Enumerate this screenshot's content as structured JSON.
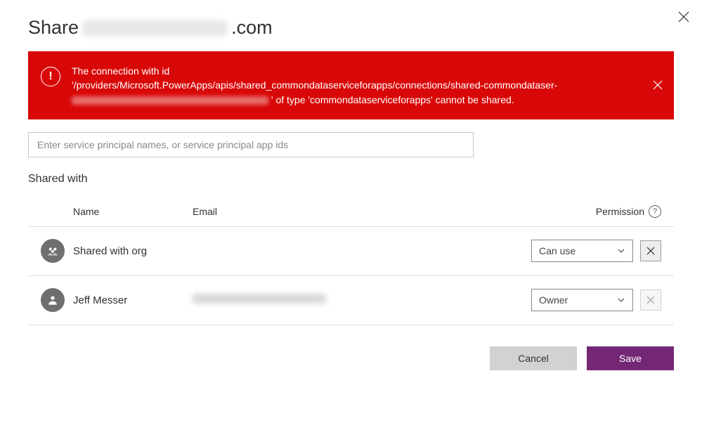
{
  "title": {
    "prefix": "Share",
    "suffix": ".com"
  },
  "error": {
    "line1": "The connection with id",
    "line2a": "'/providers/Microsoft.PowerApps/apis/shared_commondataserviceforapps/connections/shared-commondataser-",
    "line2b": "' of type 'commondataserviceforapps' cannot be shared."
  },
  "search": {
    "placeholder": "Enter service principal names, or service principal app ids"
  },
  "sharedWithHeading": "Shared with",
  "columns": {
    "name": "Name",
    "email": "Email",
    "permission": "Permission"
  },
  "helpGlyph": "?",
  "rows": [
    {
      "name": "Shared with org",
      "email": "",
      "permission": "Can use",
      "removable": true,
      "iconType": "group"
    },
    {
      "name": "Jeff Messer",
      "email": "(redacted)",
      "permission": "Owner",
      "removable": false,
      "iconType": "person"
    }
  ],
  "buttons": {
    "cancel": "Cancel",
    "save": "Save"
  }
}
